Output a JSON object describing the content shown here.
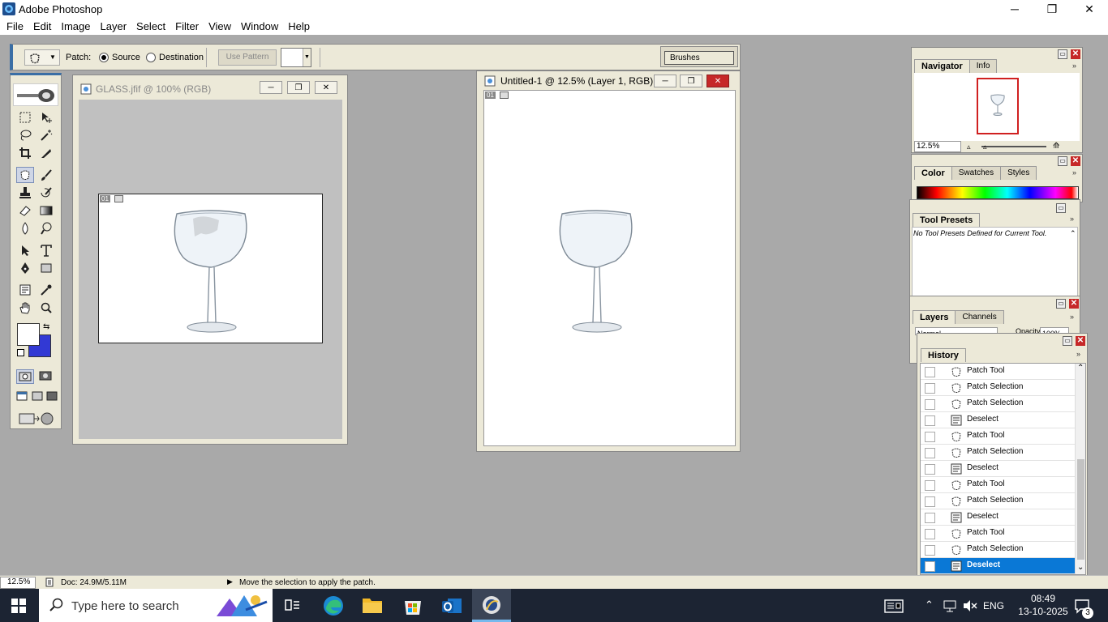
{
  "app": {
    "title": "Adobe Photoshop"
  },
  "window_controls": {
    "minimize": "─",
    "restore": "❐",
    "close": "✕"
  },
  "menu": [
    "File",
    "Edit",
    "Image",
    "Layer",
    "Select",
    "Filter",
    "View",
    "Window",
    "Help"
  ],
  "options_bar": {
    "patch_label": "Patch:",
    "source_label": "Source",
    "destination_label": "Destination",
    "source_selected": true,
    "use_pattern_label": "Use Pattern",
    "brushes_tab": "Brushes"
  },
  "toolbox": {
    "icons": [
      "rect-marquee",
      "move",
      "lasso",
      "magic-wand",
      "crop",
      "slice",
      "patch",
      "brush",
      "stamp",
      "history-brush",
      "eraser",
      "gradient",
      "blur",
      "dodge",
      "path-select",
      "type",
      "pen",
      "shape",
      "notes",
      "eyedropper",
      "hand",
      "zoom"
    ],
    "foreground_color": "#ffffff",
    "background_color": "#3239d4"
  },
  "doc1": {
    "title": "GLASS.jfif @ 100% (RGB)",
    "slice_tag": "01"
  },
  "doc2": {
    "title": "Untitled-1 @ 12.5% (Layer 1, RGB)",
    "slice_tag": "01"
  },
  "navigator": {
    "tabs": [
      "Navigator",
      "Info"
    ],
    "zoom": "12.5%"
  },
  "color_panel": {
    "tabs": [
      "Color",
      "Swatches",
      "Styles"
    ]
  },
  "tool_presets": {
    "title": "Tool Presets",
    "message": "No Tool Presets Defined for Current Tool."
  },
  "layers": {
    "tabs": [
      "Layers",
      "Channels"
    ],
    "blend_mode": "Normal",
    "opacity_label": "Opacity:",
    "opacity": "100%"
  },
  "history": {
    "title": "History",
    "items": [
      {
        "label": "Patch Tool",
        "icon": "patch"
      },
      {
        "label": "Patch Selection",
        "icon": "patch"
      },
      {
        "label": "Patch Selection",
        "icon": "patch"
      },
      {
        "label": "Deselect",
        "icon": "deselect"
      },
      {
        "label": "Patch Tool",
        "icon": "patch"
      },
      {
        "label": "Patch Selection",
        "icon": "patch"
      },
      {
        "label": "Deselect",
        "icon": "deselect"
      },
      {
        "label": "Patch Tool",
        "icon": "patch"
      },
      {
        "label": "Patch Selection",
        "icon": "patch"
      },
      {
        "label": "Deselect",
        "icon": "deselect"
      },
      {
        "label": "Patch Tool",
        "icon": "patch"
      },
      {
        "label": "Patch Selection",
        "icon": "patch"
      },
      {
        "label": "Deselect",
        "icon": "deselect",
        "current": true
      }
    ]
  },
  "status": {
    "zoom": "12.5%",
    "doc": "Doc: 24.9M/5.11M",
    "hint": "Move the selection to apply the patch."
  },
  "taskbar": {
    "search_placeholder": "Type here to search",
    "language": "ENG",
    "time": "08:49",
    "date": "13-10-2025",
    "notifications": "3"
  }
}
